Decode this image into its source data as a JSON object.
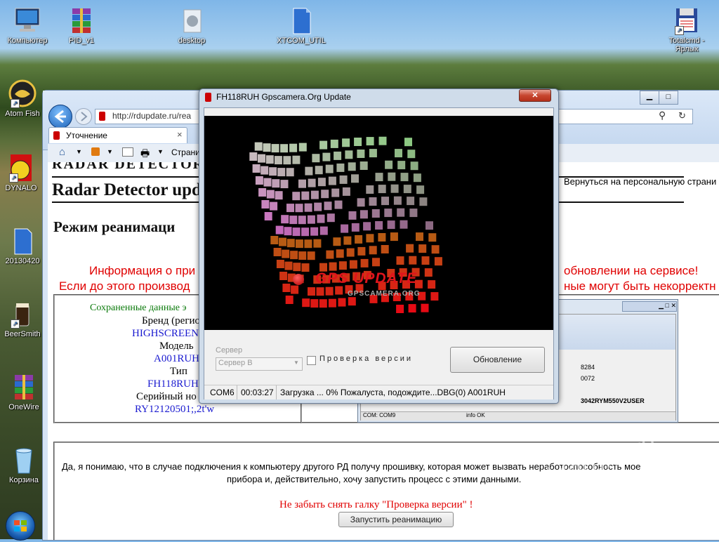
{
  "desktop": {
    "icons": [
      {
        "label": "Компьютер",
        "icon": "computer-icon"
      },
      {
        "label": "PID_v1",
        "icon": "winrar-icon"
      },
      {
        "label": "desktop",
        "icon": "folder-icon"
      },
      {
        "label": "XTCOM_UTIL",
        "icon": "folder-icon"
      },
      {
        "label": "Totalcmd - Ярлык",
        "icon": "floppy-icon"
      },
      {
        "label": "Atom Fish",
        "icon": "fish-icon"
      },
      {
        "label": "DYNALO",
        "icon": "app-icon"
      },
      {
        "label": "20130420",
        "icon": "folder-icon"
      },
      {
        "label": "BeerSmith",
        "icon": "beer-icon"
      },
      {
        "label": "OneWire",
        "icon": "winrar-icon"
      },
      {
        "label": "Корзина",
        "icon": "recycle-bin-icon"
      }
    ],
    "watermark": "rd-forum.ru",
    "start_button": "start-orb-icon"
  },
  "browser": {
    "address": "http://rdupdate.ru/rea",
    "tab_label": "Уточнение",
    "tab_close": "×",
    "toolbar_page_label": "Страни",
    "back_to_personal": "Вернуться на персональную страни",
    "site_header_top": "RADAR DETECTOR",
    "site_header": "Radar Detector update Ru",
    "page_title": "Режим реанимаци",
    "info_line1_left": "Информация о при",
    "info_line1_right": "обновлении на сервисе!",
    "info_line2_left": "Если до этого производ",
    "info_line2_right": "ные могут быть некорректн",
    "saved": {
      "heading": "Сохраненные данные э",
      "brand_label": "Бренд (регио",
      "brand_value": "HIGHSCREEN",
      "model_label": "Модель",
      "model_value": "A001RUH",
      "type_label": "Тип",
      "type_value": "FH118RUH",
      "serial_label": "Серийный но",
      "serial_value": "RY12120501;,2t'w"
    },
    "inner_window": {
      "values": [
        "8284",
        "0072"
      ],
      "serial": "3042RYM550V2USER",
      "status_left": "COM: COM9",
      "status_right": "info OK"
    },
    "agreement_line1": "Да, я понимаю, что в случае подключения к компьютеру другого РД получу прошивку, которая может вызвать неработоспособность мое",
    "agreement_line2": "прибора и, действительно, хочу запустить процесс с этими данными.",
    "reminder": "Не забыть снять галку \"Проверка версии\" !",
    "start_reanimation_button": "Запустить реанимацию"
  },
  "dialog": {
    "title": "FH118RUH  Gpscamera.Org Update",
    "close": "✕",
    "logo_title": "GPS UPDATE",
    "logo_subtitle": "GPSCAMERA.ORG",
    "server_label": "Сервер",
    "server_value": "Сервер В",
    "check_version_label": "Проверка версии",
    "update_button": "Обновление",
    "status": {
      "port": "COM6",
      "time": "00:03:27",
      "message": "Загрузка ... 0% Пожалуста, подождите...DBG(0)  A001RUH"
    }
  },
  "colors": {
    "info_red": "#e00000",
    "value_blue": "#1a1ad0",
    "heading_green": "#0a7a0a",
    "logo_red": "#e0141c"
  }
}
